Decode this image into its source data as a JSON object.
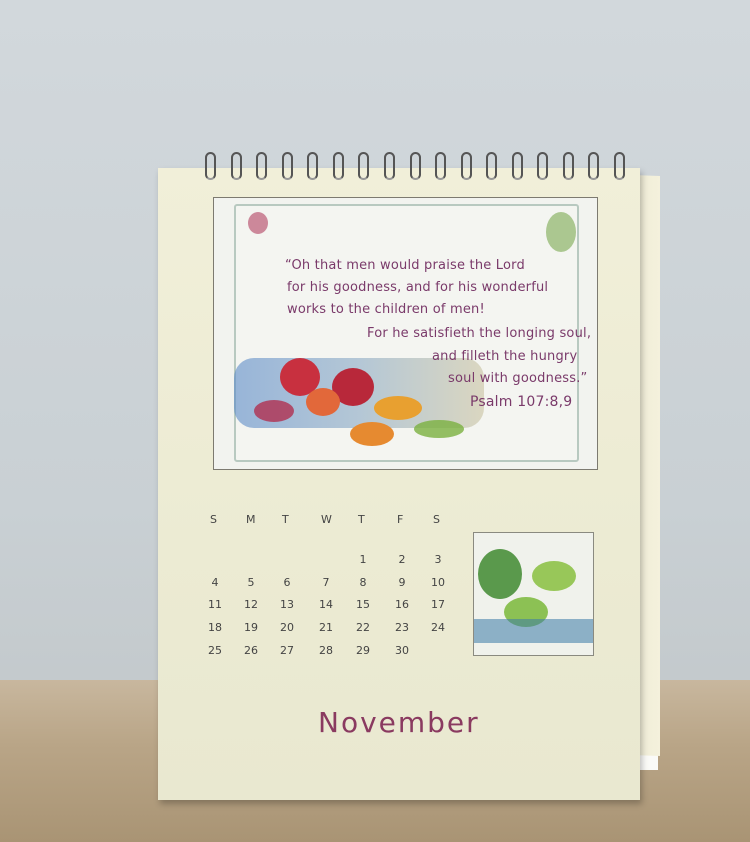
{
  "calendar": {
    "quote_lines": [
      "“Oh that men would praise the Lord",
      "for his goodness, and for his wonderful",
      "works to the children of men!",
      "For he satisfieth the longing soul,",
      "and filleth the hungry",
      "soul with goodness.”",
      "Psalm 107:8,9"
    ],
    "weekdays": [
      "S",
      "M",
      "T",
      "W",
      "T",
      "F",
      "S"
    ],
    "weeks": [
      [
        "",
        "",
        "",
        "",
        "1",
        "2",
        "3"
      ],
      [
        "4",
        "5",
        "6",
        "7",
        "8",
        "9",
        "10"
      ],
      [
        "11",
        "12",
        "13",
        "14",
        "15",
        "16",
        "17"
      ],
      [
        "18",
        "19",
        "20",
        "21",
        "22",
        "23",
        "24"
      ],
      [
        "25",
        "26",
        "27",
        "28",
        "29",
        "30",
        ""
      ]
    ],
    "month": "November",
    "colors": {
      "text_accent": "#8a3a60",
      "paper": "#eeecd6"
    }
  }
}
